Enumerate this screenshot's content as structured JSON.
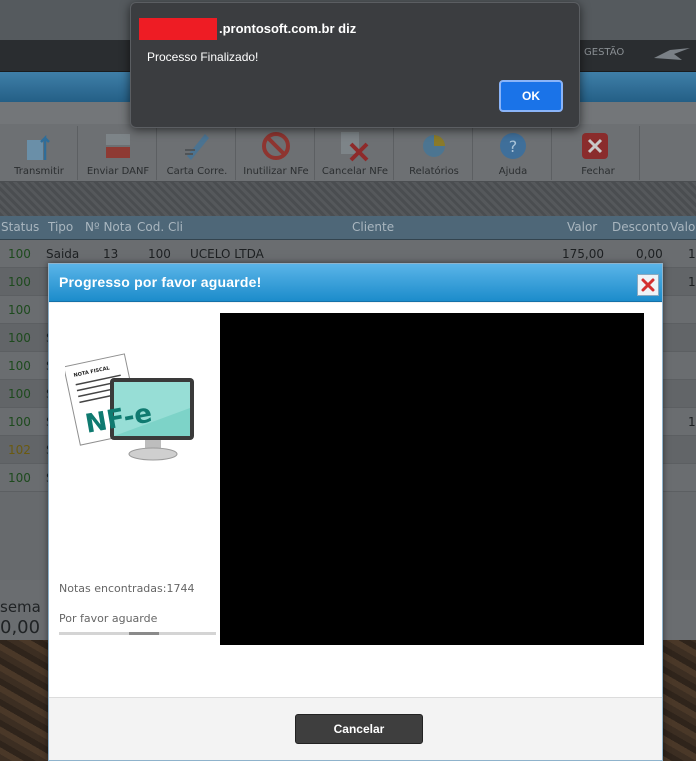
{
  "background_app": {
    "menu_label": "GESTÃO",
    "toolbar": [
      {
        "label": "Transmitir",
        "icon": "upload-icon"
      },
      {
        "label": "Enviar DANF",
        "icon": "xml-pdf-icon"
      },
      {
        "label": "Carta Corre.",
        "icon": "pen-icon"
      },
      {
        "label": "Inutilizar NFe",
        "icon": "forbidden-icon"
      },
      {
        "label": "Cancelar NFe",
        "icon": "x-mark-icon"
      },
      {
        "label": "Relatórios",
        "icon": "pie-chart-icon"
      },
      {
        "label": "Ajuda",
        "icon": "help-icon"
      },
      {
        "label": "Fechar",
        "icon": "close-icon"
      }
    ],
    "table": {
      "headers": [
        "Status",
        "Tipo",
        "Nº Nota",
        "Cod. Cli",
        "Cliente",
        "Valor",
        "Desconto",
        "Valo"
      ],
      "rows": [
        {
          "status": "100",
          "tipo": "Saida",
          "nota": "13",
          "cod": "100",
          "cliente": "UCELO LTDA",
          "valor": "175,00",
          "desconto": "0,00",
          "valo": "1"
        },
        {
          "status": "100",
          "tipo": "",
          "nota": "",
          "cod": "",
          "cliente": "",
          "valor": "",
          "desconto": "",
          "valo": "1"
        },
        {
          "status": "100",
          "tipo": "",
          "nota": "",
          "cod": "",
          "cliente": "",
          "valor": "",
          "desconto": "",
          "valo": ""
        },
        {
          "status": "100",
          "tipo": "S",
          "nota": "",
          "cod": "",
          "cliente": "",
          "valor": "",
          "desconto": "",
          "valo": ""
        },
        {
          "status": "100",
          "tipo": "S",
          "nota": "",
          "cod": "",
          "cliente": "",
          "valor": "",
          "desconto": "",
          "valo": ""
        },
        {
          "status": "100",
          "tipo": "S",
          "nota": "",
          "cod": "",
          "cliente": "",
          "valor": "",
          "desconto": "",
          "valo": ""
        },
        {
          "status": "100",
          "tipo": "S",
          "nota": "",
          "cod": "",
          "cliente": "",
          "valor": "",
          "desconto": "",
          "valo": "1"
        },
        {
          "status": "102",
          "tipo": "S",
          "nota": "",
          "cod": "",
          "cliente": "",
          "valor": "",
          "desconto": "",
          "valo": ""
        },
        {
          "status": "100",
          "tipo": "S",
          "nota": "",
          "cod": "",
          "cliente": "",
          "valor": "",
          "desconto": "",
          "valo": ""
        }
      ]
    },
    "footer": {
      "label_partial": "sema",
      "value_partial": "0,00"
    }
  },
  "alert": {
    "origin": ".prontosoft.com.br diz",
    "message": "Processo Finalizado!",
    "ok_label": "OK",
    "ok_color": "#1a73e8"
  },
  "modal": {
    "title": "Progresso por favor aguarde!",
    "graphic_caption": "NOTA FISCAL",
    "graphic_text": "NF-e",
    "notas_encontradas": "Notas encontradas:1744",
    "wait_text": "Por favor aguarde",
    "cancel_label": "Cancelar",
    "header_color": "#1c8ccb"
  }
}
